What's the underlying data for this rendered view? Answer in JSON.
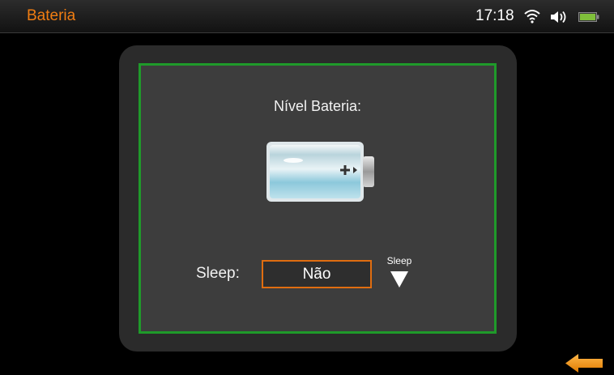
{
  "status_bar": {
    "title": "Bateria",
    "time": "17:18",
    "icons": [
      "wifi-icon",
      "volume-icon",
      "battery-icon"
    ]
  },
  "battery_panel": {
    "level_label": "Nível Bateria:",
    "battery_icon": "battery-charging-icon",
    "sleep_label": "Sleep:",
    "sleep_value": "Não",
    "dropdown_caption": "Sleep"
  },
  "navigation": {
    "back_icon": "arrow-left-icon"
  },
  "colors": {
    "accent": "#f07d12",
    "frame_border": "#1f9a2a",
    "panel_bg": "#2b2b2b",
    "inner_bg": "#3d3d3d"
  }
}
